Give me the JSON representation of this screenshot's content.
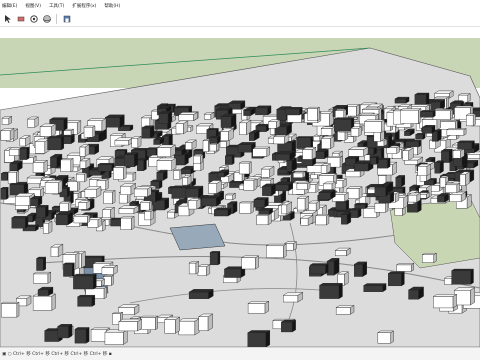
{
  "menu": {
    "items": [
      {
        "label": "编辑(E)"
      },
      {
        "label": "视图(V)"
      },
      {
        "label": "工具(T)"
      },
      {
        "label": "扩展程序(x)"
      },
      {
        "label": "帮助(H)"
      }
    ]
  },
  "toolbar": {
    "icons": [
      "select-arrow-icon",
      "eraser-icon",
      "paint-bucket-icon",
      "orbit-icon",
      "warehouse-icon"
    ]
  },
  "viewport": {
    "sky_color": "#ffffff",
    "ground_color": "#dcdcdc",
    "grass_color": "#c9d6b6",
    "axis_color": "#2e8b57"
  },
  "statusbar": {
    "text": "▣ ○ Ctrl+ 移 Ctrl+ 移 Ctrl+ 移 Ctrl+ 移 Ctrl+ 移 ▪"
  }
}
